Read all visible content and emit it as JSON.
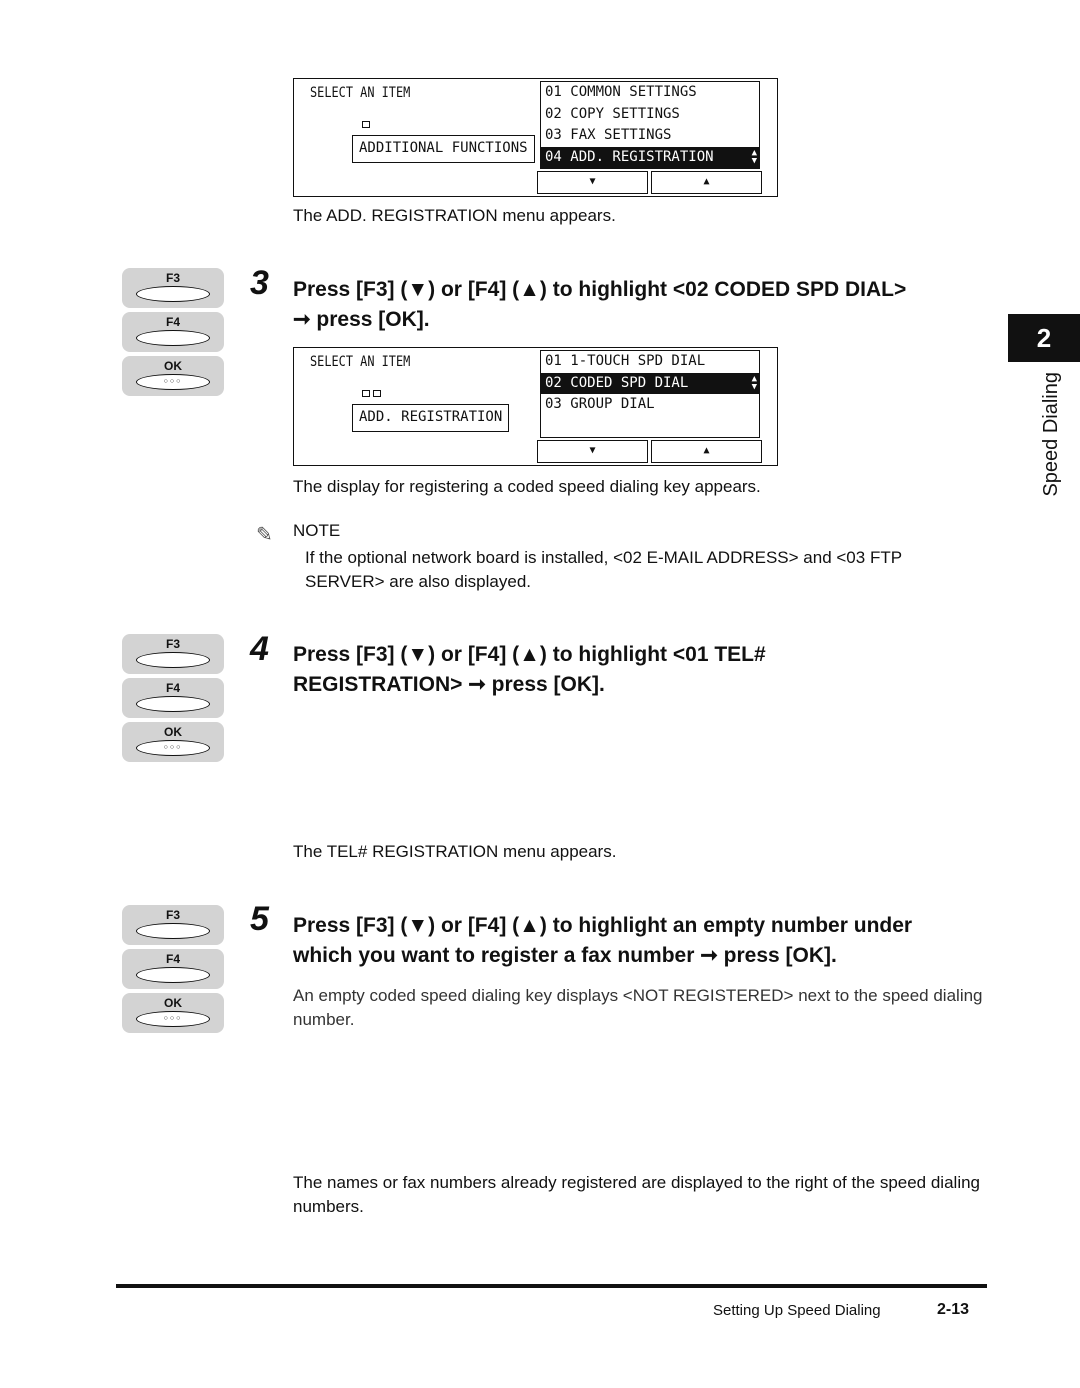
{
  "screens": [
    {
      "title": "SELECT AN ITEM",
      "path": "ADDITIONAL FUNCTIONS",
      "depth": 1,
      "items": [
        "01  COMMON SETTINGS",
        "02  COPY SETTINGS",
        "03  FAX SETTINGS",
        "04  ADD. REGISTRATION"
      ],
      "selected": 3,
      "caption": "The ADD. REGISTRATION menu appears."
    },
    {
      "title": "SELECT AN ITEM",
      "path": "ADD. REGISTRATION",
      "depth": 2,
      "items": [
        "01  1-TOUCH SPD DIAL",
        "02  CODED SPD DIAL",
        "03  GROUP DIAL"
      ],
      "selected": 1,
      "caption": "The display for registering a coded speed dialing key appears."
    }
  ],
  "lcd_buttons": {
    "down": "▼",
    "up": "▲",
    "scroll": "⬍"
  },
  "keys": {
    "f3": "F3",
    "f4": "F4",
    "ok": "OK",
    "ok_dots": "○○○"
  },
  "steps": [
    {
      "num": "3",
      "line1": "Press [F3] (▼) or [F4] (▲) to highlight <02 CODED SPD DIAL>",
      "line2": "➞ press [OK]."
    },
    {
      "num": "4",
      "line1": "Press [F3] (▼) or [F4] (▲) to highlight <01 TEL#",
      "line2": "REGISTRATION> ➞ press [OK].",
      "caption": "The TEL# REGISTRATION menu appears."
    },
    {
      "num": "5",
      "line1": "Press [F3] (▼) or [F4] (▲) to highlight an empty number under",
      "line2": "which you want to register a fax number ➞ press [OK].",
      "text1": "An empty coded speed dialing key displays <NOT REGISTERED> next to the speed dialing number.",
      "text2": "The names or fax numbers already registered are displayed to the right of the speed dialing numbers."
    }
  ],
  "note": {
    "label": "NOTE",
    "text": "If the optional network board is installed, <02 E-MAIL ADDRESS> and <03 FTP SERVER> are also displayed."
  },
  "chapter": {
    "number": "2",
    "title": "Speed Dialing"
  },
  "footer": {
    "section": "Setting Up Speed Dialing",
    "page": "2-13"
  }
}
